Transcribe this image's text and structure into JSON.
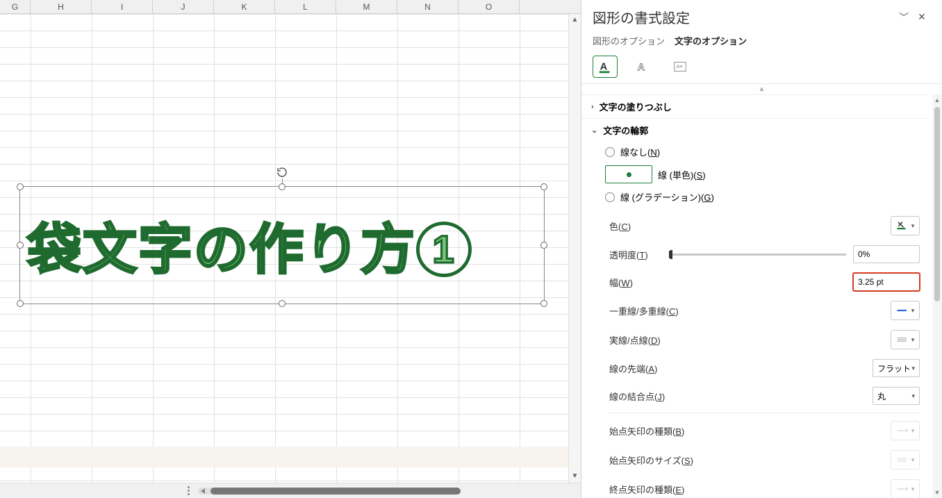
{
  "columns": [
    "G",
    "H",
    "I",
    "J",
    "K",
    "L",
    "M",
    "N",
    "O"
  ],
  "wordart_text": "袋文字の作り方",
  "wordart_num": "1",
  "panel": {
    "title": "図形の書式設定",
    "tabs": {
      "shape": "図形のオプション",
      "text": "文字のオプション"
    },
    "sections": {
      "fill": "文字の塗りつぶし",
      "outline": "文字の輪郭"
    },
    "radios": {
      "none": "線なし",
      "none_k": "N",
      "solid_a": "線 (単色)",
      "solid_k": "S",
      "grad_a": "線 (グラデーション)",
      "grad_k": "G"
    },
    "props": {
      "color": "色",
      "color_k": "C",
      "trans": "透明度",
      "trans_k": "T",
      "trans_val": "0%",
      "width": "幅",
      "width_k": "W",
      "width_val": "3.25 pt",
      "compound": "一重線/多重線",
      "compound_k": "C",
      "dash": "実線/点線",
      "dash_k": "D",
      "cap": "線の先端",
      "cap_k": "A",
      "cap_val": "フラット",
      "join": "線の結合点",
      "join_k": "J",
      "join_val": "丸",
      "arrowBeginType": "始点矢印の種類",
      "arrowBeginType_k": "B",
      "arrowBeginSize": "始点矢印のサイズ",
      "arrowBeginSize_k": "S",
      "arrowEndType": "終点矢印の種類",
      "arrowEndType_k": "E"
    }
  }
}
